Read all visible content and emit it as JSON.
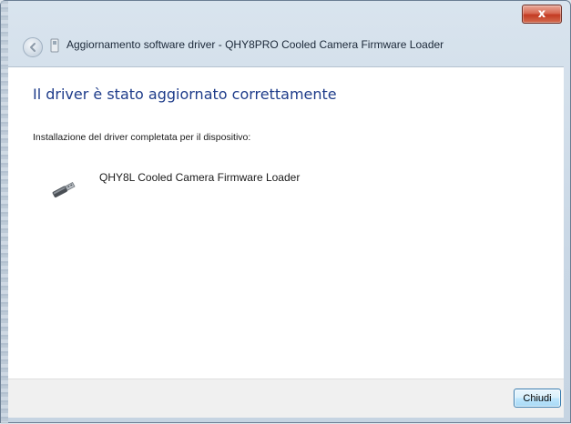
{
  "window": {
    "title": "Aggiornamento software driver - QHY8PRO Cooled Camera Firmware Loader",
    "close_glyph": "x"
  },
  "content": {
    "heading": "Il driver è stato aggiornato correttamente",
    "subtext": "Installazione del driver completata per il dispositivo:",
    "device_name": "QHY8L Cooled Camera Firmware Loader",
    "device_icon": "usb-device-icon"
  },
  "footer": {
    "close_label": "Chiudi"
  },
  "colors": {
    "heading": "#1e3c8a",
    "close_button": "#c33b22",
    "footer_bg": "#f0f0f0",
    "frame": "#c9d7e5"
  }
}
